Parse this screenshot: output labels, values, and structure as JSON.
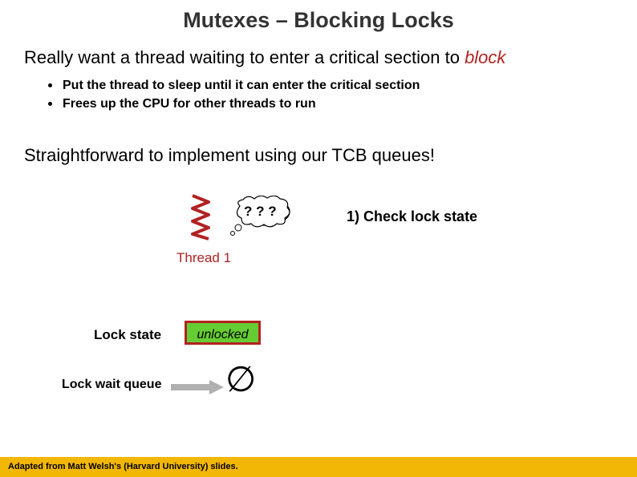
{
  "title": "Mutexes – Blocking Locks",
  "subtitle_plain": "Really want a thread waiting to enter a critical section to ",
  "subtitle_em": "block",
  "bullets": {
    "b1": "Put the thread to sleep until it can enter the critical section",
    "b2": "Frees up the CPU for other threads to run"
  },
  "tcb_line": "Straightforward to implement using our TCB queues!",
  "thought_text": "? ? ?",
  "step1": "1) Check lock state",
  "thread_caption": "Thread 1",
  "lockstate_label": "Lock state",
  "unlocked_text": "unlocked",
  "waitq_label": "Lock wait queue",
  "empty_set": "∅",
  "footer": "Adapted from Matt Welsh's (Harvard University) slides."
}
